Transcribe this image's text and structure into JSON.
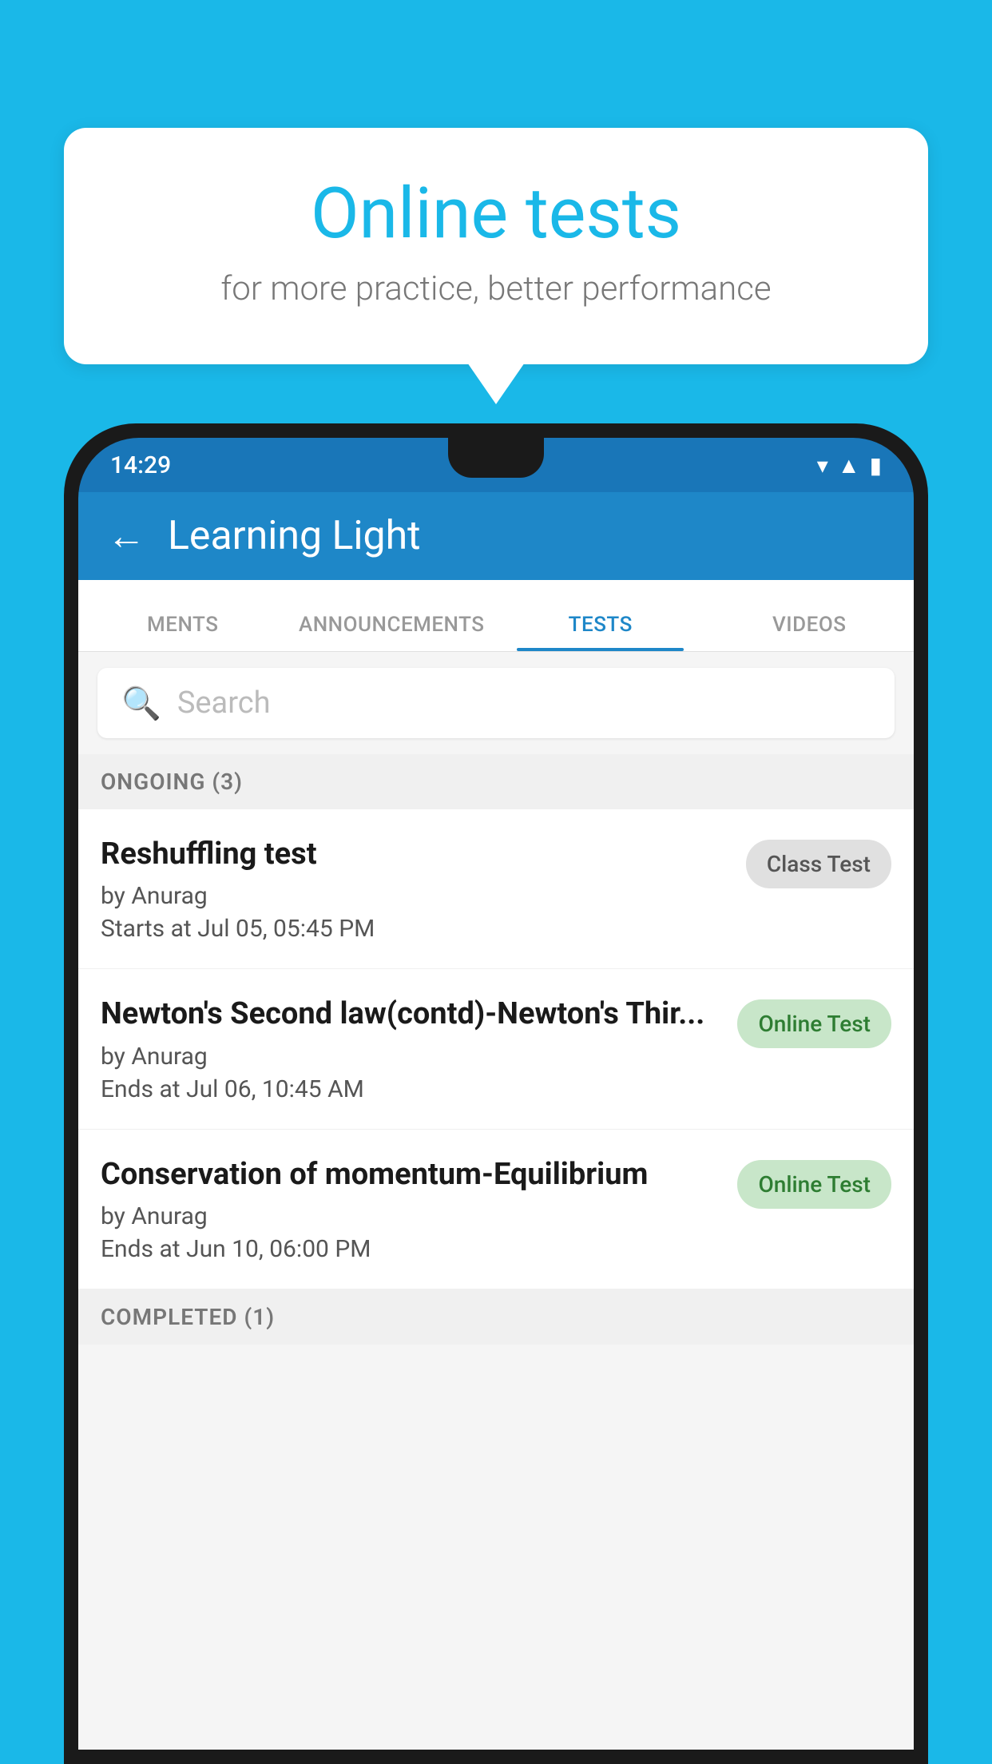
{
  "background": {
    "color": "#1ab8e8"
  },
  "speech_bubble": {
    "title": "Online tests",
    "subtitle": "for more practice, better performance"
  },
  "phone": {
    "status_bar": {
      "time": "14:29",
      "icons": [
        "wifi",
        "signal",
        "battery"
      ]
    },
    "app_bar": {
      "title": "Learning Light",
      "back_label": "←"
    },
    "tabs": [
      {
        "label": "MENTS",
        "active": false
      },
      {
        "label": "ANNOUNCEMENTS",
        "active": false
      },
      {
        "label": "TESTS",
        "active": true
      },
      {
        "label": "VIDEOS",
        "active": false
      }
    ],
    "search": {
      "placeholder": "Search"
    },
    "ongoing_section": {
      "label": "ONGOING (3)",
      "items": [
        {
          "name": "Reshuffling test",
          "by": "by Anurag",
          "date": "Starts at  Jul 05, 05:45 PM",
          "badge": "Class Test",
          "badge_type": "gray"
        },
        {
          "name": "Newton's Second law(contd)-Newton's Thir...",
          "by": "by Anurag",
          "date": "Ends at  Jul 06, 10:45 AM",
          "badge": "Online Test",
          "badge_type": "green"
        },
        {
          "name": "Conservation of momentum-Equilibrium",
          "by": "by Anurag",
          "date": "Ends at  Jun 10, 06:00 PM",
          "badge": "Online Test",
          "badge_type": "green"
        }
      ]
    },
    "completed_section": {
      "label": "COMPLETED (1)"
    }
  }
}
